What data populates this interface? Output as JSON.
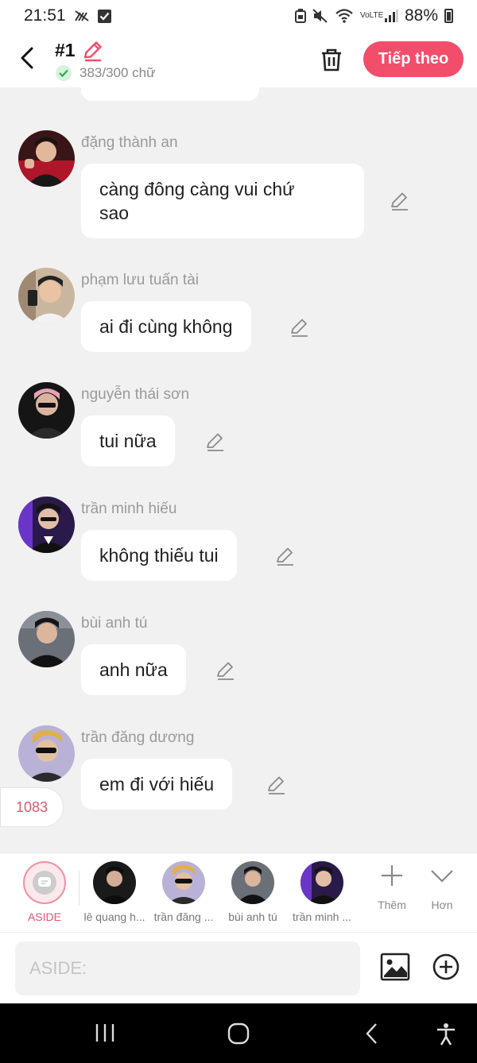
{
  "status_bar": {
    "time": "21:51",
    "network": "VoLTE",
    "battery": "88%"
  },
  "header": {
    "title": "#1",
    "char_count": "383/300 chữ",
    "next_label": "Tiếp theo"
  },
  "messages": [
    {
      "name": "đặng thành an",
      "lines": [
        "càng đông càng vui chứ",
        "sao"
      ]
    },
    {
      "name": "phạm lưu tuấn tài",
      "lines": [
        "ai đi cùng không"
      ]
    },
    {
      "name": "nguyễn thái sơn",
      "lines": [
        "tui nữa"
      ]
    },
    {
      "name": "trần minh hiếu",
      "lines": [
        "không thiếu tui"
      ]
    },
    {
      "name": "bùi anh tú",
      "lines": [
        "anh nữa"
      ]
    },
    {
      "name": "trần đăng dương",
      "lines": [
        "em đi với hiếu"
      ]
    }
  ],
  "counter": "1083",
  "character_bar": {
    "aside_label": "ASIDE",
    "characters": [
      {
        "label": "lê quang h..."
      },
      {
        "label": "trần đăng ..."
      },
      {
        "label": "bùi anh tú"
      },
      {
        "label": "trần minh ..."
      }
    ],
    "add_label": "Thêm",
    "more_label": "Hơn"
  },
  "input": {
    "placeholder": "ASIDE:",
    "value": ""
  },
  "colors": {
    "accent": "#f24e6b",
    "background": "#f1f1f1",
    "bubble": "#ffffff",
    "name_text": "#9a9a9a",
    "counter_text": "#e0566f"
  }
}
